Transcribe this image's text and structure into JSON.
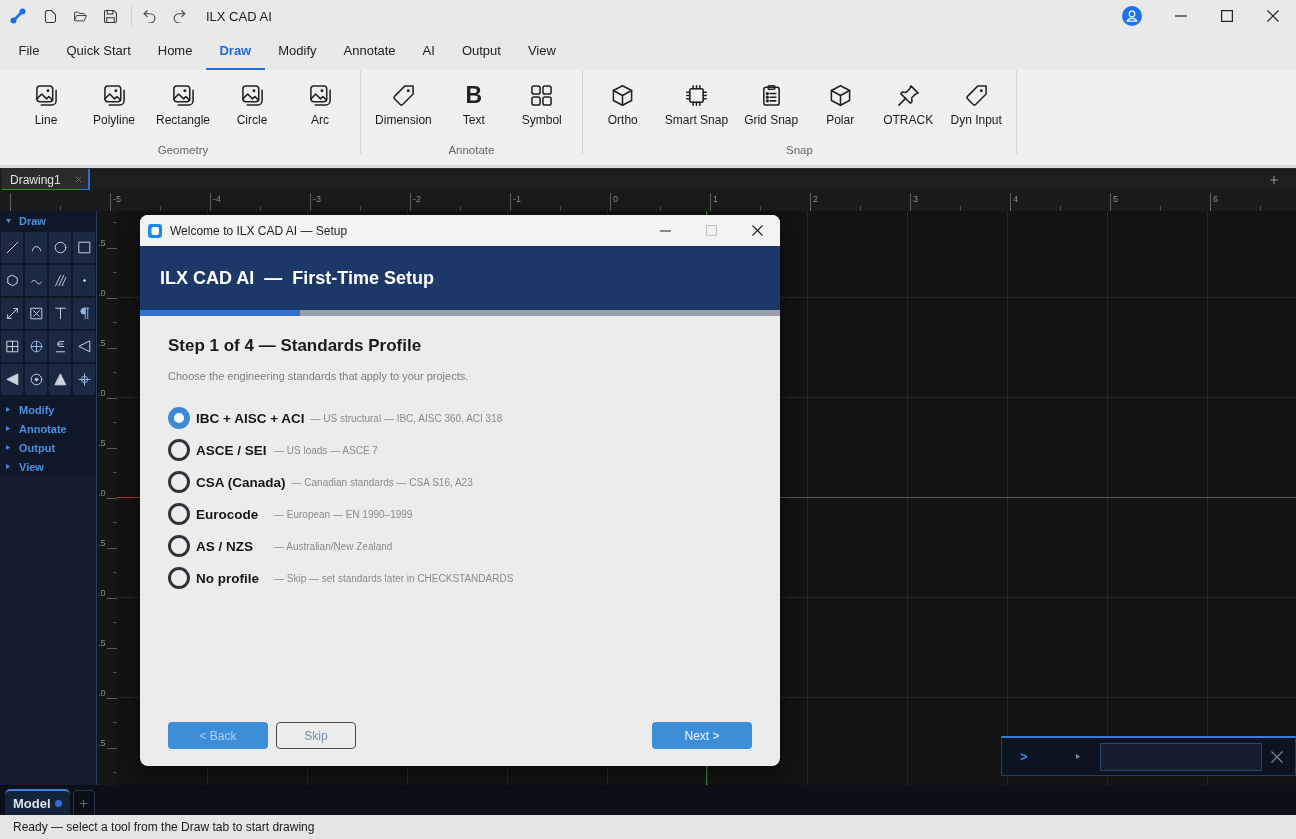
{
  "window": {
    "title": "ILX CAD AI"
  },
  "ribbon_tabs": [
    {
      "label": "File",
      "selected": false
    },
    {
      "label": "Quick Start",
      "selected": false
    },
    {
      "label": "Home",
      "selected": false
    },
    {
      "label": "Draw",
      "selected": true
    },
    {
      "label": "Modify",
      "selected": false
    },
    {
      "label": "Annotate",
      "selected": false
    },
    {
      "label": "AI",
      "selected": false
    },
    {
      "label": "Output",
      "selected": false
    },
    {
      "label": "View",
      "selected": false
    }
  ],
  "ribbon_groups": [
    {
      "title": "Geometry",
      "items": [
        {
          "label": "Line"
        },
        {
          "label": "Polyline"
        },
        {
          "label": "Rectangle"
        },
        {
          "label": "Circle"
        },
        {
          "label": "Arc"
        }
      ]
    },
    {
      "title": "Annotate",
      "items": [
        {
          "label": "Dimension"
        },
        {
          "label": "Text",
          "glyph": "B"
        },
        {
          "label": "Symbol"
        }
      ]
    },
    {
      "title": "Snap",
      "items": [
        {
          "label": "Ortho"
        },
        {
          "label": "Smart Snap"
        },
        {
          "label": "Grid Snap"
        },
        {
          "label": "Polar"
        },
        {
          "label": "OTRACK"
        },
        {
          "label": "Dyn Input"
        }
      ]
    }
  ],
  "document_tabs": [
    {
      "label": "Drawing1",
      "selected": true
    }
  ],
  "ruler": {
    "x_labels": [
      "-5",
      "-4",
      "-3",
      "-2",
      "-1",
      "0",
      "1",
      "2",
      "3",
      "4",
      "5",
      "6"
    ],
    "y_labels": [
      ".5",
      ".0",
      ".5",
      ".0",
      ".5",
      ".0",
      ".5",
      ".0",
      ".5",
      ".0",
      ".5"
    ]
  },
  "tool_palette": {
    "sections": [
      {
        "label": "Draw",
        "expanded": true
      },
      {
        "label": "Modify",
        "expanded": false
      },
      {
        "label": "Annotate",
        "expanded": false
      },
      {
        "label": "Output",
        "expanded": false
      },
      {
        "label": "View",
        "expanded": false
      }
    ]
  },
  "dialog": {
    "title": "Welcome to ILX CAD AI — Setup",
    "banner": "ILX CAD AI  —  First-Time Setup",
    "progress": {
      "level": 0.25
    },
    "step_title": "Step 1 of 4 — Standards Profile",
    "subtitle": "Choose the engineering standards that apply to your projects.",
    "options": [
      {
        "label": "IBC + AISC + ACI",
        "description": "— US structural — IBC, AISC 360, ACI 318",
        "selected": true
      },
      {
        "label": "ASCE / SEI",
        "description": "— US loads — ASCE 7",
        "selected": false
      },
      {
        "label": "CSA (Canada)",
        "description": "— Canadian standards — CSA S16, A23",
        "selected": false
      },
      {
        "label": "Eurocode",
        "description": "— European — EN 1990–1999",
        "selected": false
      },
      {
        "label": "AS / NZS",
        "description": "— Australian/New Zealand",
        "selected": false
      },
      {
        "label": "No profile",
        "description": "— Skip — set standards later in CHECKSTANDARDS",
        "selected": false
      }
    ],
    "buttons": [
      {
        "label": "< Back",
        "kind": "primary",
        "disabled": true
      },
      {
        "label": "Skip",
        "kind": "secondary",
        "disabled": true
      },
      {
        "label": "Next >",
        "kind": "primary",
        "disabled": false
      }
    ]
  },
  "command_line": {
    "prompt": ">"
  },
  "layout_tabs": [
    {
      "label": "Model",
      "selected": true
    }
  ],
  "status_bar": {
    "text": "Ready — select a tool from the Draw tab to start drawing"
  }
}
